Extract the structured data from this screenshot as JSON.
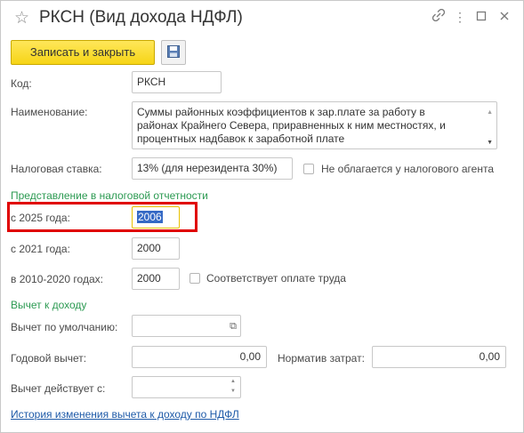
{
  "window": {
    "title": "РКСН (Вид дохода НДФЛ)"
  },
  "toolbar": {
    "save_close_label": "Записать и закрыть"
  },
  "form": {
    "code_label": "Код:",
    "code_value": "РКСН",
    "name_label": "Наименование:",
    "name_lines": [
      "Суммы районных коэффициентов к зар.плате за работу в",
      "районах Крайнего Севера, приравненных к ним местностях, и",
      "процентных надбавок к заработной плате"
    ],
    "tax_rate_label": "Налоговая ставка:",
    "tax_rate_value": "13% (для нерезидента 30%)",
    "not_taxed_label": "Не облагается у налогового агента",
    "reporting_section": "Представление в налоговой отчетности",
    "from_2025_label": "с 2025 года:",
    "from_2025_value": "2006",
    "from_2021_label": "с 2021 года:",
    "from_2021_value": "2000",
    "y2010_2020_label": "в 2010-2020 годах:",
    "y2010_2020_value": "2000",
    "labor_payment_label": "Соответствует оплате труда",
    "deduction_section": "Вычет к доходу",
    "default_deduction_label": "Вычет по умолчанию:",
    "default_deduction_value": "",
    "annual_deduction_label": "Годовой вычет:",
    "annual_deduction_value": "0,00",
    "expense_norm_label": "Норматив затрат:",
    "expense_norm_value": "0,00",
    "deduction_valid_from_label": "Вычет действует с:",
    "deduction_valid_from_value": "",
    "history_link": "История изменения вычета к доходу по НДФЛ"
  },
  "colors": {
    "primary_button": "#f6d416",
    "group_title": "#2c9a52",
    "link": "#1e5aa8",
    "highlight_border": "#e00000"
  }
}
